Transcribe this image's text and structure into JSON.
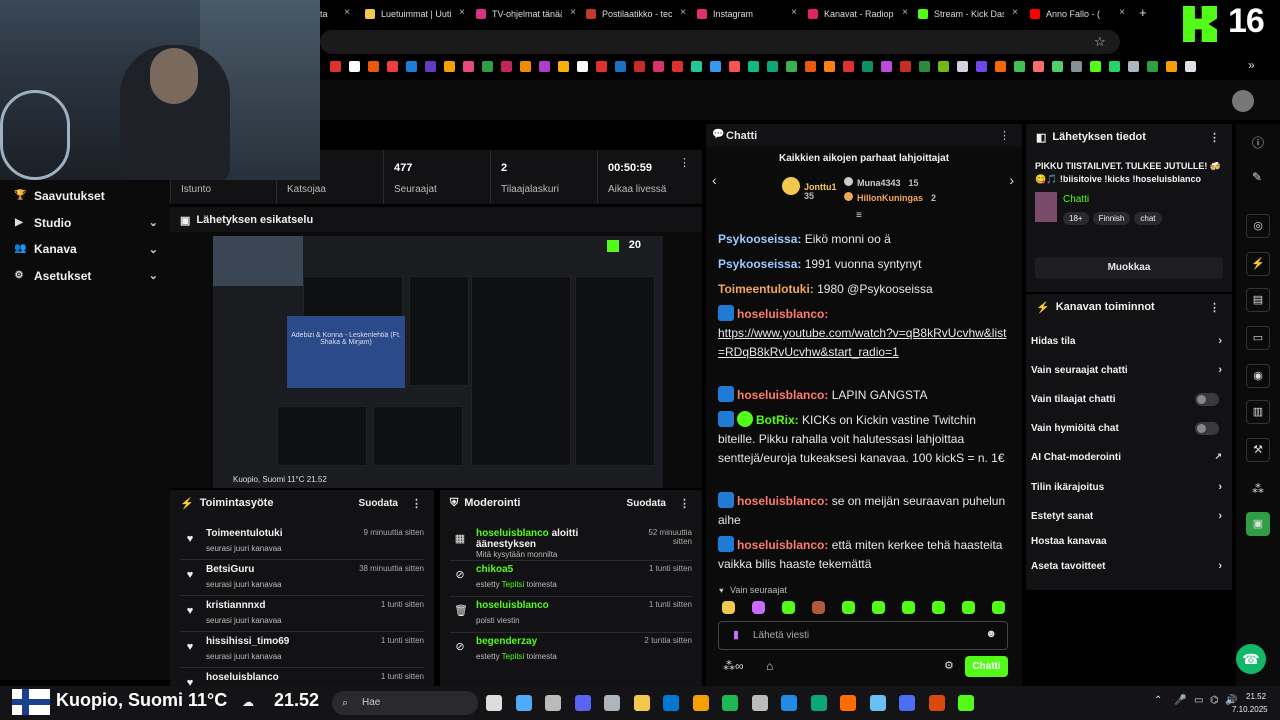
{
  "browser": {
    "tabs": [
      {
        "label": "llta",
        "color": "#888888"
      },
      {
        "label": "Luetuimmat | Uutiset",
        "color": "#f2c94c"
      },
      {
        "label": "TV-ohjelmat tänään",
        "color": "#d63384"
      },
      {
        "label": "Postilaatikko - tec",
        "color": "#c0392b"
      },
      {
        "label": "Instagram",
        "color": "#e1306c"
      },
      {
        "label": "Kanavat - Radioplay",
        "color": "#e0245e"
      },
      {
        "label": "Stream - Kick Dash",
        "color": "#53fc18"
      },
      {
        "label": "Anno Fallo - (",
        "color": "#ff0000"
      }
    ],
    "close_glyph": "×",
    "new_tab_glyph": "+"
  },
  "overlay": {
    "viewer_number": "16"
  },
  "leftnav": {
    "items": [
      {
        "label": "Saavutukset",
        "icon": "trophy-icon",
        "glyph": "🏆",
        "chevron": false
      },
      {
        "label": "Studio",
        "icon": "video-icon",
        "glyph": "▶",
        "chevron": true
      },
      {
        "label": "Kanava",
        "icon": "people-icon",
        "glyph": "👥",
        "chevron": true
      },
      {
        "label": "Asetukset",
        "icon": "gear-icon",
        "glyph": "⚙",
        "chevron": true
      }
    ],
    "chevron_glyph": "⌄"
  },
  "stats": {
    "items": [
      {
        "value": "",
        "label": "Istunto"
      },
      {
        "value": "",
        "label": "Katsojaa"
      },
      {
        "value": "477",
        "label": "Seuraajat"
      },
      {
        "value": "2",
        "label": "Tilaajalaskuri"
      },
      {
        "value": "00:50:59",
        "label": "Aikaa livessä"
      }
    ]
  },
  "preview": {
    "title": "Lähetyksen esikatselu",
    "mini_caption": "Adebizi & Konna - Leskenlehtiä (Ft. Shaka & Mirjam)",
    "mini_number": "20",
    "mini_location": "Kuopio, Suomi 11°C   21.52"
  },
  "activity": {
    "title": "Toimintasyöte",
    "filter": "Suodata",
    "items": [
      {
        "name": "Toimeentulotuki",
        "sub": "seurasi juuri kanavaa",
        "time": "9 minuuttia sitten"
      },
      {
        "name": "BetsiGuru",
        "sub": "seurasi juuri kanavaa",
        "time": "38 minuuttia sitten"
      },
      {
        "name": "kristiannnxd",
        "sub": "seurasi juuri kanavaa",
        "time": "1 tunti sitten"
      },
      {
        "name": "hissihissi_timo69",
        "sub": "seurasi juuri kanavaa",
        "time": "1 tunti sitten"
      },
      {
        "name": "hoseluisblanco",
        "sub": "",
        "time": "1 tunti sitten"
      }
    ]
  },
  "moderation": {
    "title": "Moderointi",
    "filter": "Suodata",
    "items": [
      {
        "icon": "poll-icon",
        "glyph": "▦",
        "name": "hoseluisblanco",
        "rest": " aloitti äänestyksen",
        "sub_pre": "Mitä kysytään monnilta",
        "sub_green": "",
        "sub_post": "",
        "time": "52 minuuttia sitten"
      },
      {
        "icon": "ban-icon",
        "glyph": "⊘",
        "name": "chikoa5",
        "rest": "",
        "sub_pre": "estetty ",
        "sub_green": "Tepitsi",
        "sub_post": " toimesta",
        "time": "1 tunti sitten"
      },
      {
        "icon": "trash-icon",
        "glyph": "🗑",
        "name": "hoseluisblanco",
        "rest": "",
        "sub_pre": "poisti viestin",
        "sub_green": "",
        "sub_post": "",
        "time": "1 tunti sitten"
      },
      {
        "icon": "ban-icon",
        "glyph": "⊘",
        "name": "begenderzay",
        "rest": "",
        "sub_pre": "estetty ",
        "sub_green": "Tepitsi",
        "sub_post": " toimesta",
        "time": "2 tuntia sitten"
      }
    ]
  },
  "chat": {
    "title": "Chatti",
    "gifters_title": "Kaikkien aikojen parhaat lahjoittajat",
    "gifters": [
      {
        "name": "Jonttu1",
        "count": "35",
        "color": "#f2c94c"
      },
      {
        "name": "Muna4343",
        "count": "15",
        "color": "#cccccc"
      },
      {
        "name": "HillonKuningas",
        "count": "2",
        "color": "#f2a65a"
      }
    ],
    "messages": [
      {
        "user": "Psykooseissa",
        "color": "#9ec9ff",
        "text": "Eikö monni oo ä",
        "badge": false,
        "verified": false,
        "link": false
      },
      {
        "user": "Psykooseissa",
        "color": "#9ec9ff",
        "text": "1991 vuonna syntynyt",
        "badge": false,
        "verified": false,
        "link": false
      },
      {
        "user": "Toimeentulotuki",
        "color": "#f2a65a",
        "text": "1980 @Psykooseissa",
        "badge": false,
        "verified": false,
        "link": false
      },
      {
        "user": "hoseluisblanco",
        "color": "#ff7b6b",
        "text": "https://www.youtube.com/watch?v=qB8kRvUcvhw&list=RDqB8kRvUcvhw&start_radio=1",
        "badge": true,
        "verified": false,
        "link": true
      },
      {
        "user": "hoseluisblanco",
        "color": "#ff7b6b",
        "text": "LAPIN GANGSTA",
        "badge": true,
        "verified": false,
        "link": false
      },
      {
        "user": "BotRix",
        "color": "#53fc18",
        "text": "KICKs on Kickin vastine Twitchin biteille. Pikku rahalla voit halutessasi lahjoittaa senttejä/euroja tukeaksesi kanavaa. 100 kickS = n. 1€",
        "badge": true,
        "verified": true,
        "link": false
      },
      {
        "user": "hoseluisblanco",
        "color": "#ff7b6b",
        "text": "se on meijän seuraavan puhelun aihe",
        "badge": true,
        "verified": false,
        "link": false
      },
      {
        "user": "hoseluisblanco",
        "color": "#ff7b6b",
        "text": "että miten kerkee tehä haasteita vaikka bilis haaste tekemättä",
        "badge": true,
        "verified": false,
        "link": false
      }
    ],
    "followers_only": "Vain seuraajat",
    "input_placeholder": "Lähetä viesti",
    "send_label": "Chatti"
  },
  "stream_info": {
    "title": "Lähetyksen tiedot",
    "stream_title": "PIKKU TIISTAILIVET. TULKEE JUTULLE! 🍻😋🎵 !biisitoive !kicks !hoseluisblanco",
    "category": "Chatti",
    "tags": [
      "18+",
      "Finnish",
      "chat"
    ],
    "edit_label": "Muokkaa"
  },
  "channel_actions": {
    "title": "Kanavan toiminnot",
    "items": [
      {
        "label": "Hidas tila",
        "control": "chevron"
      },
      {
        "label": "Vain seuraajat chatti",
        "control": "chevron"
      },
      {
        "label": "Vain tilaajat chatti",
        "control": "toggle"
      },
      {
        "label": "Vain hymiöitä chat",
        "control": "toggle"
      },
      {
        "label": "AI Chat-moderointi",
        "control": "external"
      },
      {
        "label": "Tilin ikärajoitus",
        "control": "chevron"
      },
      {
        "label": "Estetyt sanat",
        "control": "chevron"
      },
      {
        "label": "Hostaa kanavaa",
        "control": "none"
      },
      {
        "label": "Aseta tavoitteet",
        "control": "chevron"
      }
    ]
  },
  "taskbar": {
    "weather": "Kuopio, Suomi 11°C",
    "clock_overlay": "21.52",
    "search_placeholder": "Hae",
    "time": "21.52",
    "date": "7.10.2025"
  },
  "colors": {
    "accent": "#53fc18",
    "panel": "#121214",
    "bg": "#0b0b0c"
  }
}
